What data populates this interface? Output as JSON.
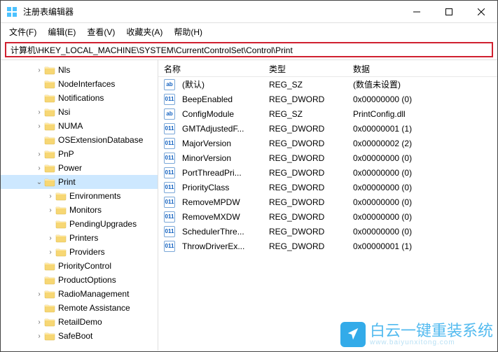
{
  "window": {
    "title": "注册表编辑器"
  },
  "menu": {
    "file": "文件(F)",
    "edit": "编辑(E)",
    "view": "查看(V)",
    "favorites": "收藏夹(A)",
    "help": "帮助(H)"
  },
  "address": "计算机\\HKEY_LOCAL_MACHINE\\SYSTEM\\CurrentControlSet\\Control\\Print",
  "columns": {
    "name": "名称",
    "type": "类型",
    "data": "数据"
  },
  "tree": [
    {
      "label": "Nls",
      "depth": 2,
      "chev": ">"
    },
    {
      "label": "NodeInterfaces",
      "depth": 2,
      "chev": ""
    },
    {
      "label": "Notifications",
      "depth": 2,
      "chev": ""
    },
    {
      "label": "Nsi",
      "depth": 2,
      "chev": ">"
    },
    {
      "label": "NUMA",
      "depth": 2,
      "chev": ">"
    },
    {
      "label": "OSExtensionDatabase",
      "depth": 2,
      "chev": ""
    },
    {
      "label": "PnP",
      "depth": 2,
      "chev": ">"
    },
    {
      "label": "Power",
      "depth": 2,
      "chev": ">"
    },
    {
      "label": "Print",
      "depth": 2,
      "chev": "v",
      "selected": true,
      "open": true
    },
    {
      "label": "Environments",
      "depth": 3,
      "chev": ">"
    },
    {
      "label": "Monitors",
      "depth": 3,
      "chev": ">"
    },
    {
      "label": "PendingUpgrades",
      "depth": 3,
      "chev": ""
    },
    {
      "label": "Printers",
      "depth": 3,
      "chev": ">"
    },
    {
      "label": "Providers",
      "depth": 3,
      "chev": ">"
    },
    {
      "label": "PriorityControl",
      "depth": 2,
      "chev": ""
    },
    {
      "label": "ProductOptions",
      "depth": 2,
      "chev": ""
    },
    {
      "label": "RadioManagement",
      "depth": 2,
      "chev": ">"
    },
    {
      "label": "Remote Assistance",
      "depth": 2,
      "chev": ""
    },
    {
      "label": "RetailDemo",
      "depth": 2,
      "chev": ">"
    },
    {
      "label": "SafeBoot",
      "depth": 2,
      "chev": ">"
    }
  ],
  "values": [
    {
      "icon": "ab",
      "name": "(默认)",
      "type": "REG_SZ",
      "data": "(数值未设置)"
    },
    {
      "icon": "01",
      "name": "BeepEnabled",
      "type": "REG_DWORD",
      "data": "0x00000000 (0)"
    },
    {
      "icon": "ab",
      "name": "ConfigModule",
      "type": "REG_SZ",
      "data": "PrintConfig.dll"
    },
    {
      "icon": "01",
      "name": "GMTAdjustedF...",
      "type": "REG_DWORD",
      "data": "0x00000001 (1)"
    },
    {
      "icon": "01",
      "name": "MajorVersion",
      "type": "REG_DWORD",
      "data": "0x00000002 (2)"
    },
    {
      "icon": "01",
      "name": "MinorVersion",
      "type": "REG_DWORD",
      "data": "0x00000000 (0)"
    },
    {
      "icon": "01",
      "name": "PortThreadPri...",
      "type": "REG_DWORD",
      "data": "0x00000000 (0)"
    },
    {
      "icon": "01",
      "name": "PriorityClass",
      "type": "REG_DWORD",
      "data": "0x00000000 (0)"
    },
    {
      "icon": "01",
      "name": "RemoveMPDW",
      "type": "REG_DWORD",
      "data": "0x00000000 (0)"
    },
    {
      "icon": "01",
      "name": "RemoveMXDW",
      "type": "REG_DWORD",
      "data": "0x00000000 (0)"
    },
    {
      "icon": "01",
      "name": "SchedulerThre...",
      "type": "REG_DWORD",
      "data": "0x00000000 (0)"
    },
    {
      "icon": "01",
      "name": "ThrowDriverEx...",
      "type": "REG_DWORD",
      "data": "0x00000001 (1)"
    }
  ],
  "watermark": {
    "brand": "白云一键重装系统",
    "url": "www.baiyunxitong.com"
  }
}
